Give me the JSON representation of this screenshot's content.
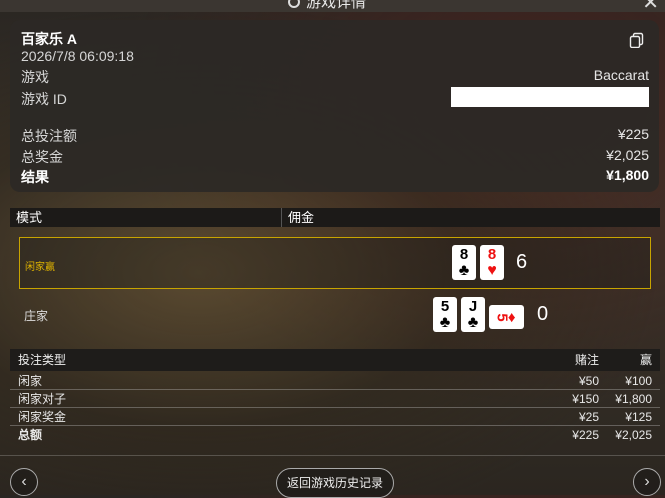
{
  "header": {
    "title": "游戏详情",
    "close_glyph": "✕"
  },
  "summary": {
    "table_name": "百家乐 A",
    "datetime": "2026/7/8 06:09:18",
    "game_label": "游戏",
    "game_value": "Baccarat",
    "game_id_label": "游戏 ID",
    "total_bet_label": "总投注额",
    "total_bet_value": "¥225",
    "total_prize_label": "总奖金",
    "total_prize_value": "¥2,025",
    "result_label": "结果",
    "result_value": "¥1,800"
  },
  "mode": {
    "col1": "模式",
    "col2": "佣金"
  },
  "hands": {
    "player": {
      "label": "闲家赢",
      "cards": [
        {
          "rank": "8",
          "suit": "♣"
        },
        {
          "rank": "8",
          "suit": "♥"
        }
      ],
      "score": "6"
    },
    "banker": {
      "label": "庄家",
      "cards": [
        {
          "rank": "5",
          "suit": "♣"
        },
        {
          "rank": "J",
          "suit": "♣"
        },
        {
          "rank": "5",
          "suit": "♦"
        }
      ],
      "score": "0"
    }
  },
  "bets": {
    "headers": {
      "type": "投注类型",
      "bet": "赌注",
      "win": "赢"
    },
    "rows": [
      {
        "type": "闲家",
        "bet": "¥50",
        "win": "¥100"
      },
      {
        "type": "闲家对子",
        "bet": "¥150",
        "win": "¥1,800"
      },
      {
        "type": "闲家奖金",
        "bet": "¥25",
        "win": "¥125"
      },
      {
        "type": "总额",
        "bet": "¥225",
        "win": "¥2,025"
      }
    ]
  },
  "footer": {
    "back_label": "返回游戏历史记录",
    "prev_glyph": "‹",
    "next_glyph": "›"
  },
  "colors": {
    "winner_border": "#c8a400",
    "winner_text": "#e0b400",
    "red_suit": "#e11111"
  },
  "icons": {
    "copy": "copy-icon",
    "refresh": "refresh-icon",
    "close": "close-icon"
  }
}
